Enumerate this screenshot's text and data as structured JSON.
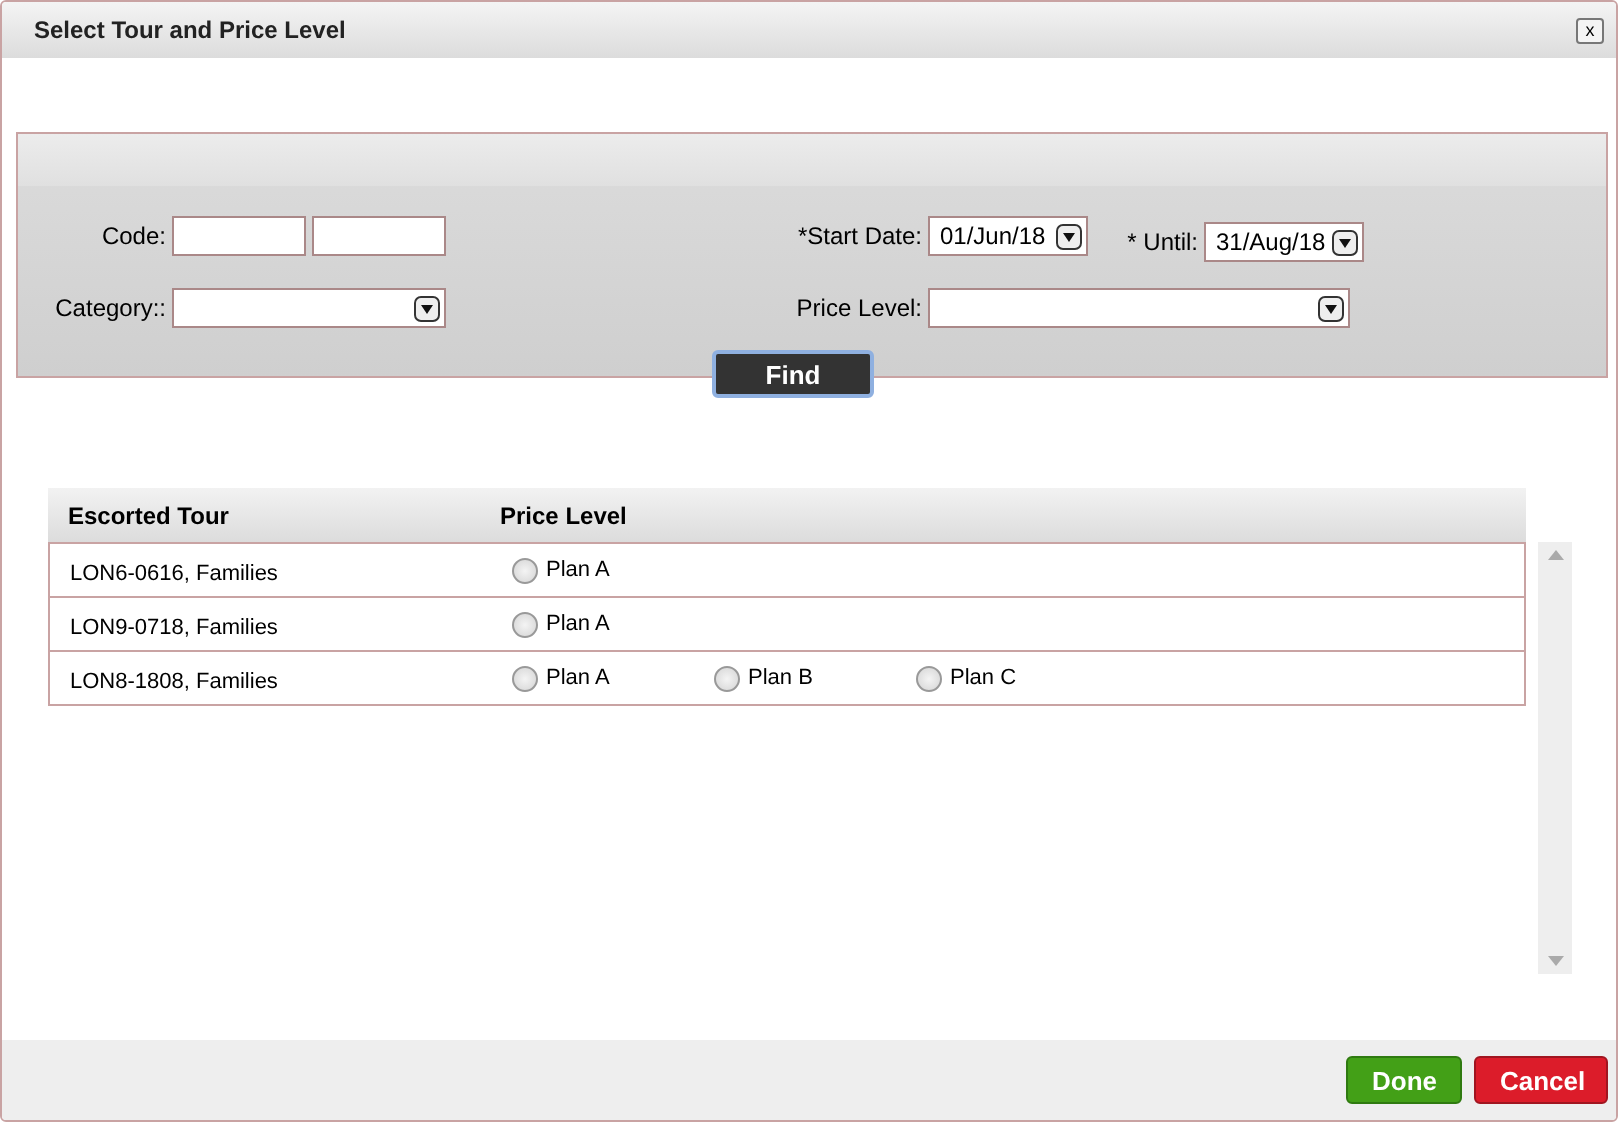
{
  "window": {
    "title": "Select Tour and Price Level",
    "close_label": "x"
  },
  "filters": {
    "code_label": "Code:",
    "category_label": "Category::",
    "start_label": "*Start Date:",
    "start_value": "01/Jun/18",
    "until_label": "* Until:",
    "until_value": "31/Aug/18",
    "price_label": "Price Level:",
    "find_button": "Find"
  },
  "table": {
    "columns": [
      "Escorted Tour",
      "Price Level"
    ],
    "rows": [
      {
        "tour": "LON6-0616, Families",
        "plans": [
          {
            "label": "Plan A",
            "selected": false
          }
        ]
      },
      {
        "tour": "LON9-0718, Families",
        "plans": [
          {
            "label": "Plan A",
            "selected": false
          }
        ]
      },
      {
        "tour": "LON8-1808, Families",
        "plans": [
          {
            "label": "Plan A",
            "selected": false
          },
          {
            "label": "Plan B",
            "selected": false
          },
          {
            "label": "Plan C",
            "selected": false
          }
        ]
      }
    ]
  },
  "buttons": [
    {
      "label": "Done",
      "kind": "confirm"
    },
    {
      "label": "Cancel",
      "kind": "cancel"
    }
  ]
}
